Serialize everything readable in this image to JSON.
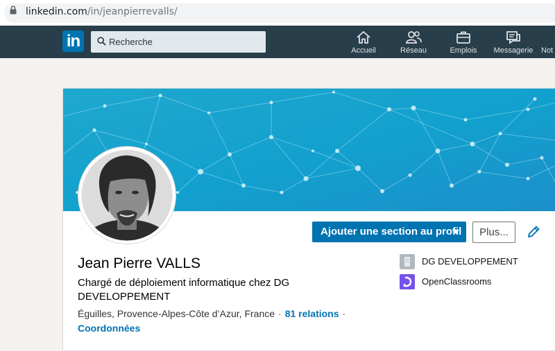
{
  "browser": {
    "url_host": "linkedin.com",
    "url_path": "/in/jeanpierrevalls/"
  },
  "nav": {
    "logo_text": "in",
    "search_placeholder": "Recherche",
    "items": [
      {
        "label": "Accueil",
        "icon": "home-icon"
      },
      {
        "label": "Réseau",
        "icon": "network-icon"
      },
      {
        "label": "Emplois",
        "icon": "briefcase-icon"
      },
      {
        "label": "Messagerie",
        "icon": "messaging-icon"
      },
      {
        "label": "Not",
        "icon": "notifications-icon"
      }
    ],
    "colors": {
      "bar": "#283e4a",
      "brand": "#0073b1"
    }
  },
  "profile": {
    "name": "Jean Pierre VALLS",
    "headline": "Chargé de déploiement informatique chez DG DEVELOPPEMENT",
    "location": "Éguilles, Provence-Alpes-Côte d’Azur, France",
    "separator": "·",
    "relations": "81 relations",
    "contact_link": "Coordonnées",
    "add_section_button": "Ajouter une section au profil",
    "more_button": "Plus...",
    "companies": [
      {
        "name": "DG DEVELOPPEMENT",
        "icon": "company-building-icon",
        "color": "#b0b7bd"
      },
      {
        "name": "OpenClassrooms",
        "icon": "openclassrooms-logo-icon",
        "color": "#7451eb"
      }
    ]
  }
}
